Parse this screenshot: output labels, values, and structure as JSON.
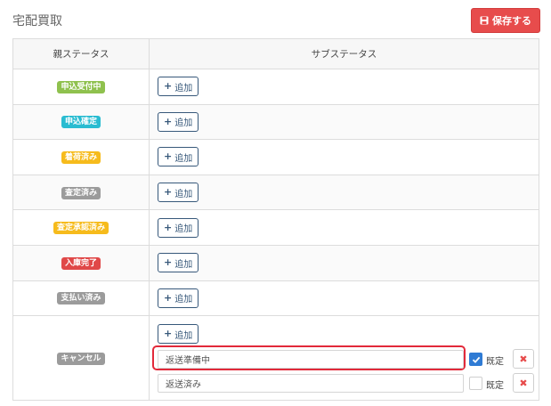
{
  "page": {
    "title": "宅配買取",
    "save_label": "保存する"
  },
  "table": {
    "header_parent": "親ステータス",
    "header_sub": "サブステータス",
    "add_label": "追加",
    "rows": [
      {
        "badge": "申込受付中",
        "color": "#8fc14e"
      },
      {
        "badge": "申込確定",
        "color": "#29bcd1"
      },
      {
        "badge": "着荷済み",
        "color": "#f6bb1c"
      },
      {
        "badge": "査定済み",
        "color": "#9b9b9b"
      },
      {
        "badge": "査定承認済み",
        "color": "#f6bb1c"
      },
      {
        "badge": "入庫完了",
        "color": "#e04848"
      },
      {
        "badge": "支払い済み",
        "color": "#9b9b9b"
      }
    ],
    "cancel_row": {
      "badge": "キャンセル",
      "color": "#9b9b9b",
      "substatuses": [
        {
          "value": "返送準備中",
          "default_checked": true,
          "default_label": "既定"
        },
        {
          "value": "返送済み",
          "default_checked": false,
          "default_label": "既定"
        }
      ]
    }
  },
  "colors": {
    "save_button": "#e74c4c",
    "add_button_border": "#37587a",
    "highlight": "#e2293a"
  },
  "icons": {
    "save": "save-icon",
    "plus": "plus-icon",
    "check": "check-icon",
    "delete": "close-icon"
  }
}
